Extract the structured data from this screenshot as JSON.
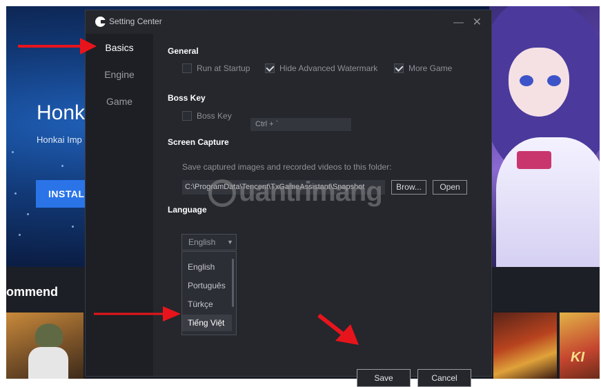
{
  "background": {
    "hero_title": "Honk",
    "hero_subtitle": "Honkai Imp",
    "install_label": "INSTAL",
    "recommend_label": "ommend",
    "thumb_text": "KI"
  },
  "dialog": {
    "title": "Setting Center",
    "minimize_glyph": "—",
    "close_glyph": "✕",
    "sidebar": [
      {
        "label": "Basics",
        "active": true
      },
      {
        "label": "Engine",
        "active": false
      },
      {
        "label": "Game",
        "active": false
      }
    ],
    "general": {
      "title": "General",
      "options": [
        {
          "label": "Run at Startup",
          "checked": false
        },
        {
          "label": "Hide Advanced Watermark",
          "checked": true
        },
        {
          "label": "More Game",
          "checked": true
        }
      ]
    },
    "boss_key": {
      "title": "Boss Key",
      "checkbox_label": "Boss Key",
      "checked": false,
      "shortcut_value": "Ctrl + `"
    },
    "screen_capture": {
      "title": "Screen Capture",
      "description": "Save captured images and recorded videos to this folder:",
      "path": "C:\\ProgramData\\Tencent\\TxGameAssistant\\Snapshot",
      "browse_label": "Brow...",
      "open_label": "Open"
    },
    "language": {
      "title": "Language",
      "selected": "English",
      "options": [
        "English",
        "Português",
        "Türkçe",
        "Tiếng Việt"
      ],
      "highlighted": "Tiếng Việt"
    },
    "save_label": "Save",
    "cancel_label": "Cancel"
  },
  "watermark": {
    "text": "uantrimang"
  },
  "colors": {
    "dialog_bg": "#25272d",
    "sidebar_bg": "#1d1f24",
    "accent_blue": "#2a74e8",
    "annotation_red": "#e8141c"
  },
  "icons": [
    "app-logo-icon",
    "minimize-icon",
    "close-icon",
    "checkbox-checked-icon",
    "chevron-down-icon",
    "red-arrow-icon"
  ]
}
